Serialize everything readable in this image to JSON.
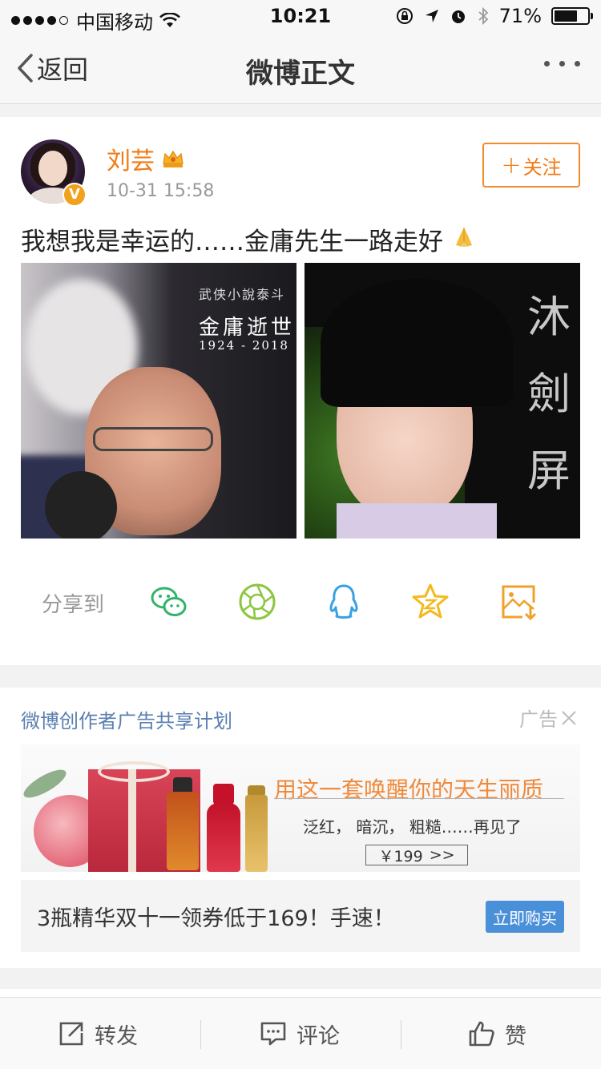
{
  "status_bar": {
    "carrier": "中国移动",
    "time": "10:21",
    "battery": "71%",
    "battery_level": 0.71
  },
  "nav": {
    "back_label": "返回",
    "title": "微博正文"
  },
  "post": {
    "username": "刘芸",
    "time": "10-31 15:58",
    "follow_label": "关注",
    "text": "我想我是幸运的……金庸先生一路走好",
    "image1": {
      "top_line": "武侠小說泰斗",
      "title": "金庸逝世",
      "years": "1924 - 2018"
    },
    "image2": {
      "calligraphy": [
        "沐",
        "劍",
        "屏"
      ]
    },
    "share_label": "分享到",
    "share_targets": [
      "wechat-icon",
      "moments-icon",
      "qq-icon",
      "qzone-icon",
      "save-image-icon"
    ]
  },
  "ad": {
    "title": "微博创作者广告共享计划",
    "tag": "广告",
    "banner": {
      "headline": "用这一套唤醒你的天生丽质",
      "subline": "泛红， 暗沉， 粗糙……再见了",
      "price": "￥199",
      "price_arrow": ">>"
    },
    "text": "3瓶精华双十一领券低于169！手速！",
    "button": "立即购买"
  },
  "toolbar": {
    "repost": "转发",
    "comment": "评论",
    "like": "赞"
  },
  "colors": {
    "username": "#f27a14",
    "follow_border": "#f28b2a",
    "ad_title": "#5a7fb0",
    "buy_button": "#4a90d9"
  }
}
